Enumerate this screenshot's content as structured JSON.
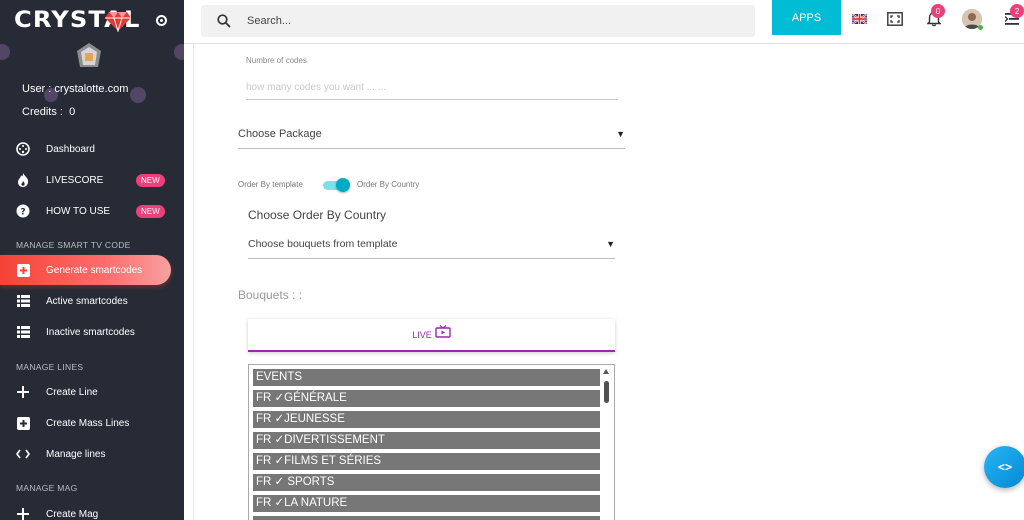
{
  "sidebar": {
    "logo": "CRYSTAL",
    "user_label": "User :",
    "user_value": "crystalotte.com",
    "credits_label": "Credits :",
    "credits_value": "0",
    "items": [
      {
        "label": "Dashboard",
        "icon": "dashboard-icon"
      },
      {
        "label": "LIVESCORE",
        "icon": "fire-icon",
        "badge": "NEW"
      },
      {
        "label": "HOW TO USE",
        "icon": "help-icon",
        "badge": "NEW"
      }
    ],
    "sections": [
      {
        "title": "MANAGE SMART TV CODE",
        "items": [
          {
            "label": "Generate smartcodes",
            "icon": "plus-square-icon",
            "active": true
          },
          {
            "label": "Active smartcodes",
            "icon": "list-icon"
          },
          {
            "label": "Inactive smartcodes",
            "icon": "list-icon"
          }
        ]
      },
      {
        "title": "MANAGE LINES",
        "items": [
          {
            "label": "Create Line",
            "icon": "plus-icon"
          },
          {
            "label": "Create Mass Lines",
            "icon": "plus-square-icon"
          },
          {
            "label": "Manage lines",
            "icon": "code-icon"
          }
        ]
      },
      {
        "title": "MANAGE MAG",
        "items": [
          {
            "label": "Create Mag",
            "icon": "plus-icon"
          }
        ]
      }
    ],
    "accent_active": "#f44336"
  },
  "topbar": {
    "search_placeholder": "Search...",
    "apps_label": "APPS",
    "notifications_count": "0",
    "menu_count": "2",
    "apps_color": "#00bcd4"
  },
  "form": {
    "codes_label": "Numbre of codes",
    "codes_placeholder": "how many codes you want ... ...",
    "package_select": "Choose Package",
    "toggle_left": "Order By template",
    "toggle_right": "Order By Country",
    "toggle_state": "on",
    "order_title": "Choose Order By Country",
    "bouquets_select": "Choose bouquets from template",
    "bouquets_label": "Bouquets : :",
    "live_tab": "LIVE",
    "bouquets": [
      "EVENTS",
      "FR ✓GÉNÉRALE",
      "FR ✓JEUNESSE",
      "FR ✓DIVERTISSEMENT",
      "FR ✓FILMS ET SÉRIES",
      "FR ✓ SPORTS",
      "FR ✓LA NATURE",
      ""
    ]
  },
  "fab": {
    "label": "<>"
  }
}
